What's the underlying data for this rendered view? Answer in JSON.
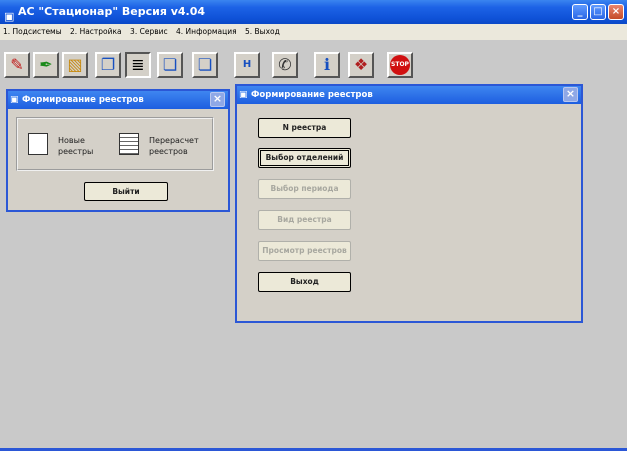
{
  "window": {
    "title": "АС \"Стационар\"   Версия  v4.04"
  },
  "menu": [
    "1. Подсистемы",
    "2. Настройка",
    "3. Сервис",
    "4. Информация",
    "5. Выход"
  ],
  "toolbar": {
    "items": [
      {
        "name": "edit-doc-icon",
        "glyph": "✎"
      },
      {
        "name": "syringe-icon",
        "glyph": "✒"
      },
      {
        "name": "folder-icon",
        "glyph": "▧"
      },
      {
        "name": "copy-doc-icon",
        "glyph": "❐"
      },
      {
        "name": "list-icon",
        "glyph": "≣"
      },
      {
        "name": "pages-icon",
        "glyph": "❏"
      },
      {
        "name": "pages2-icon",
        "glyph": "❏"
      },
      {
        "name": "h-icon",
        "glyph": "H"
      },
      {
        "name": "wrench-icon",
        "glyph": "✆"
      },
      {
        "name": "info-icon",
        "glyph": "ℹ"
      },
      {
        "name": "book-icon",
        "glyph": "❖"
      },
      {
        "name": "stop-icon",
        "glyph": "STOP"
      }
    ]
  },
  "dialog1": {
    "title": "Формирование реестров",
    "tiles": [
      {
        "label": "Новые\nреестры"
      },
      {
        "label": "Перерасчет\nреестров"
      }
    ],
    "exit_label": "Выйти"
  },
  "dialog2": {
    "title": "Формирование реестров",
    "buttons": [
      {
        "label": "N реестра",
        "enabled": true
      },
      {
        "label": "Выбор отделений",
        "enabled": true
      },
      {
        "label": "Выбор периода",
        "enabled": false
      },
      {
        "label": "Вид реестра",
        "enabled": false
      },
      {
        "label": "Просмотр реестров",
        "enabled": false
      },
      {
        "label": "Выход",
        "enabled": true
      }
    ]
  },
  "colors": {
    "titlebar": "#0f52d8",
    "dialog_border": "#2b57d6",
    "background": "#c9c9c9"
  }
}
